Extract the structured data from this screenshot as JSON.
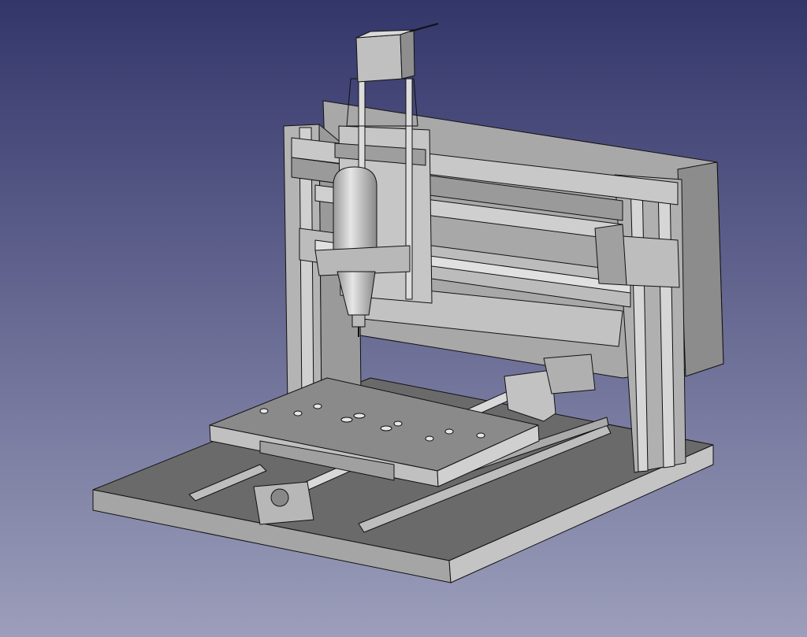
{
  "viewport": {
    "type": "3d-cad-view",
    "background_top": "#33366a",
    "background_bottom": "#9c9ebb",
    "model_face_light": "#c8c8c8",
    "model_face_mid": "#a9a9a9",
    "model_face_dark": "#6e6e6e",
    "edge_color": "#111111"
  }
}
